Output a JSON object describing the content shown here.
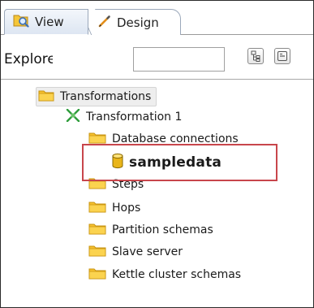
{
  "tabs": [
    {
      "label": "View",
      "icon": "view-icon",
      "active": true
    },
    {
      "label": "Design",
      "icon": "pencil-icon",
      "active": false
    }
  ],
  "explorer": {
    "label": "Explorer",
    "search_value": "",
    "expand_icon": "expand-all-icon",
    "collapse_icon": "collapse-all-icon"
  },
  "tree": {
    "root": {
      "label": "Transformations",
      "icon": "folder-icon"
    },
    "transformation": {
      "label": "Transformation 1",
      "icon": "transformation-icon"
    },
    "children": [
      {
        "label": "Database connections",
        "icon": "folder-icon"
      },
      {
        "label": "sampledata",
        "icon": "database-icon"
      },
      {
        "label": "Steps",
        "icon": "folder-icon"
      },
      {
        "label": "Hops",
        "icon": "folder-icon"
      },
      {
        "label": "Partition schemas",
        "icon": "folder-icon"
      },
      {
        "label": "Slave server",
        "icon": "folder-icon"
      },
      {
        "label": "Kettle cluster schemas",
        "icon": "folder-icon"
      }
    ]
  },
  "colors": {
    "folder": "#f7c12e",
    "database": "#e9b51a",
    "transformation": "#2f9d3c",
    "highlight": "#c8464c",
    "tab_active": "#dde6f2"
  }
}
